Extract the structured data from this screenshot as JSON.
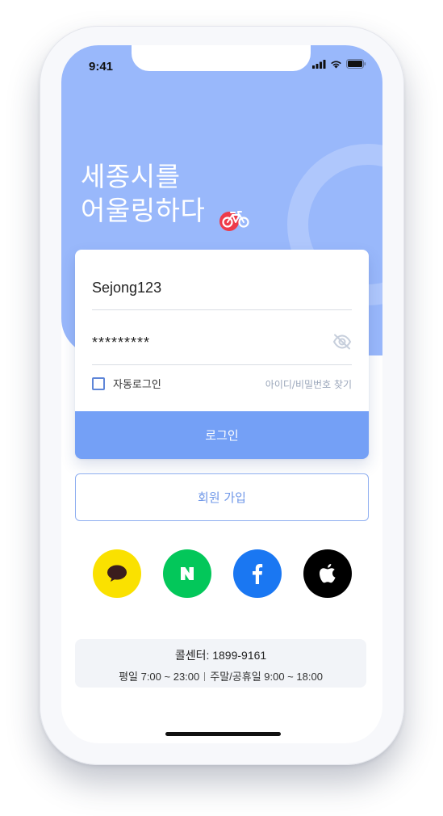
{
  "status_bar": {
    "time": "9:41"
  },
  "hero": {
    "title_line1": "세종시를",
    "title_line2": "어울링하다",
    "bike_icon": "bicycle-icon"
  },
  "login": {
    "id_value": "Sejong123",
    "password_value": "*********",
    "auto_login_label": "자동로그인",
    "auto_login_checked": false,
    "find_account_label": "아이디/비밀번호 찾기",
    "login_button": "로그인"
  },
  "signup": {
    "label": "회원 가입"
  },
  "social": [
    {
      "name": "kakao",
      "icon": "speech-bubble-icon",
      "color": "#fae100"
    },
    {
      "name": "naver",
      "icon": "naver-n-icon",
      "color": "#03c75a"
    },
    {
      "name": "facebook",
      "icon": "facebook-f-icon",
      "color": "#1a77f2"
    },
    {
      "name": "apple",
      "icon": "apple-icon",
      "color": "#000000"
    }
  ],
  "call_center": {
    "line1": "콜센터: 1899-9161",
    "weekday": "평일 7:00 ~ 23:00",
    "weekend": "주말/공휴일 9:00 ~ 18:00"
  },
  "colors": {
    "hero_bg": "#99b8fb",
    "primary": "#74a0f6",
    "accent_red": "#ee3b4a"
  }
}
